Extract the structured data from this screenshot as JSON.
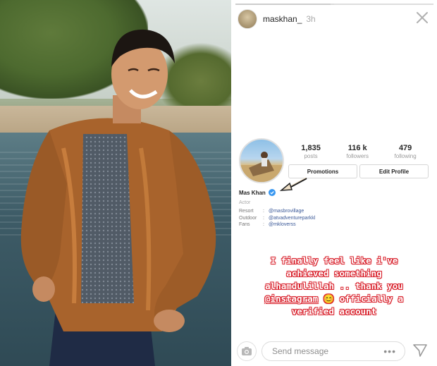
{
  "story": {
    "username": "maskhan_",
    "time": "3h",
    "profile": {
      "posts": {
        "num": "1,835",
        "label": "posts"
      },
      "followers": {
        "num": "116 k",
        "label": "followers"
      },
      "following": {
        "num": "479",
        "label": "following"
      },
      "promotions_label": "Promotions",
      "edit_label": "Edit Profile",
      "name": "Mas Khan",
      "category": "Actor",
      "bio": [
        {
          "key": "Resort",
          "sep": ":",
          "value": "@masbrovillage"
        },
        {
          "key": "Outdoor",
          "sep": ":",
          "value": "@atvadventureparkkl"
        },
        {
          "key": "Fans",
          "sep": ":",
          "value": "@mkloverss"
        }
      ]
    },
    "message": {
      "line1": "I finally feel like i've",
      "line2": "achieved something",
      "line3": "alhamdulillah .. thank you",
      "line4_mention": "@instagram",
      "line4_emoji": "😊",
      "line4_rest": "officially a",
      "line5": "verified account"
    },
    "reply": {
      "placeholder": "Send message",
      "more": "•••"
    }
  },
  "colors": {
    "verified": "#3897f0",
    "message_outline": "#d81f2a",
    "link": "#3b5998"
  },
  "icons": [
    "camera-icon",
    "close-icon",
    "verified-badge-icon",
    "direct-send-icon",
    "more-icon",
    "pointer-arrow"
  ]
}
